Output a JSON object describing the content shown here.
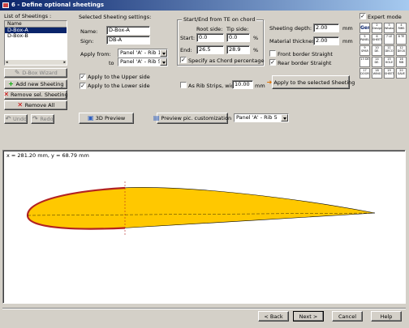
{
  "window": {
    "title": "6 - Define optional sheetings"
  },
  "left": {
    "list_label": "List of Sheetings :",
    "column_header": "Name",
    "items": [
      "D-Box-A",
      "D-Box-B"
    ],
    "buttons": {
      "wizard": "D-Box Wizard",
      "add": "Add new Sheeting",
      "remove_sel": "Remove sel. Sheeting",
      "remove_all": "Remove All"
    }
  },
  "selected": {
    "group_title": "Selected Sheeting settings:",
    "name_label": "Name:",
    "name_value": "D-Box-A",
    "sign_label": "Sign:",
    "sign_value": "DB-A",
    "apply_from_label": "Apply from:",
    "apply_from_value": "Panel 'A' - Rib 1",
    "to_label": "to",
    "to_value": "Panel 'A' - Rib 5",
    "upper_label": "Apply to the Upper side",
    "lower_label": "Apply to the Lower side"
  },
  "startend": {
    "group_title": "Start/End from TE on chord",
    "root_label": "Root side:",
    "tip_label": "Tip side:",
    "start_label": "Start:",
    "end_label": "End:",
    "start_root": "0.0",
    "start_tip": "0.0",
    "end_root": "26.5",
    "end_tip": "28.9",
    "unit": "%",
    "chord_pct_label": "Specify as Chord percentage",
    "rib_strips_label": "As Rib Strips, width:",
    "rib_strips_value": "10.00",
    "rib_strips_unit": "mm"
  },
  "right": {
    "depth_label": "Sheeting depth:",
    "depth_value": "2.00",
    "thickness_label": "Material thickness:",
    "thickness_value": "2.00",
    "unit": "mm",
    "front_label": "Front border Straight",
    "rear_label": "Rear border Straight",
    "apply_button": "Apply to the selected Sheeting",
    "expert_label": "Expert mode",
    "tools": [
      "Gen",
      "2 Design",
      "3 Wisdom",
      "4 RIBS",
      "5 PANEL",
      "6 SHEET",
      "7 LE",
      "8 TE",
      "9 SPAR",
      "10 DE.",
      "11 DECO",
      "12 DECK",
      "13 DE",
      "14 DE.",
      "15 HOLE",
      "16 RIB",
      "17 DOOR",
      "18 WING",
      "19 SHEET",
      "20 SAVE"
    ]
  },
  "toolbar": {
    "undo": "Undo",
    "redo": "Redo",
    "preview3d": "3D Preview",
    "preview_custom": "Preview pic. customization",
    "panel_select": "Panel 'A' - Rib 5"
  },
  "canvas": {
    "coords": "x = 281.20 mm, y = 68.79 mm"
  },
  "footer": {
    "back": "< Back",
    "next": "Next >",
    "cancel": "Cancel",
    "help": "Help"
  },
  "colors": {
    "airfoil_fill": "#ffc800",
    "sheeting": "#b22222",
    "outline": "#000000"
  }
}
